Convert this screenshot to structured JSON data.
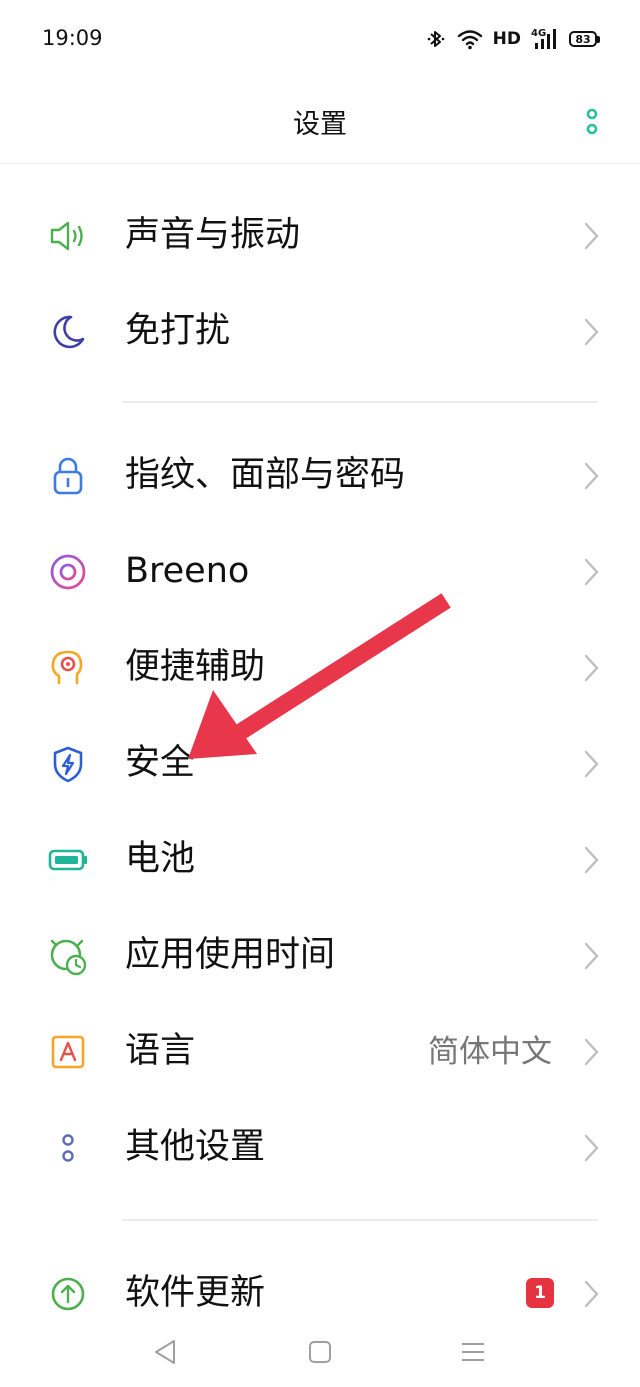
{
  "status_bar": {
    "time": "19:09",
    "network_label": "HD",
    "signal_label": "4G",
    "battery_level": "83",
    "icons": [
      "bluetooth-icon",
      "wifi-icon",
      "signal-icon",
      "battery-icon"
    ]
  },
  "header": {
    "title": "设置",
    "menu_icon": "more-vertical-icon"
  },
  "settings": {
    "sound": {
      "label": "声音与振动",
      "icon": "speaker-icon"
    },
    "dnd": {
      "label": "免打扰",
      "icon": "moon-icon"
    },
    "security_pass": {
      "label": "指纹、面部与密码",
      "icon": "lock-icon"
    },
    "breeno": {
      "label": "Breeno",
      "icon": "breeno-icon"
    },
    "accessibility": {
      "label": "便捷辅助",
      "icon": "head-icon"
    },
    "security": {
      "label": "安全",
      "icon": "shield-bolt-icon"
    },
    "battery": {
      "label": "电池",
      "icon": "battery-icon"
    },
    "usage": {
      "label": "应用使用时间",
      "icon": "clock-icon"
    },
    "language": {
      "label": "语言",
      "value": "简体中文",
      "icon": "language-icon"
    },
    "other": {
      "label": "其他设置",
      "icon": "dots-icon"
    },
    "update": {
      "label": "软件更新",
      "badge": "1",
      "icon": "update-icon"
    }
  },
  "colors": {
    "accent": "#2bbf9a",
    "badge": "#e5343f",
    "annotation_arrow": "#e8374a"
  },
  "nav_bar": {
    "icons": [
      "back-icon",
      "home-icon",
      "recents-icon"
    ]
  }
}
